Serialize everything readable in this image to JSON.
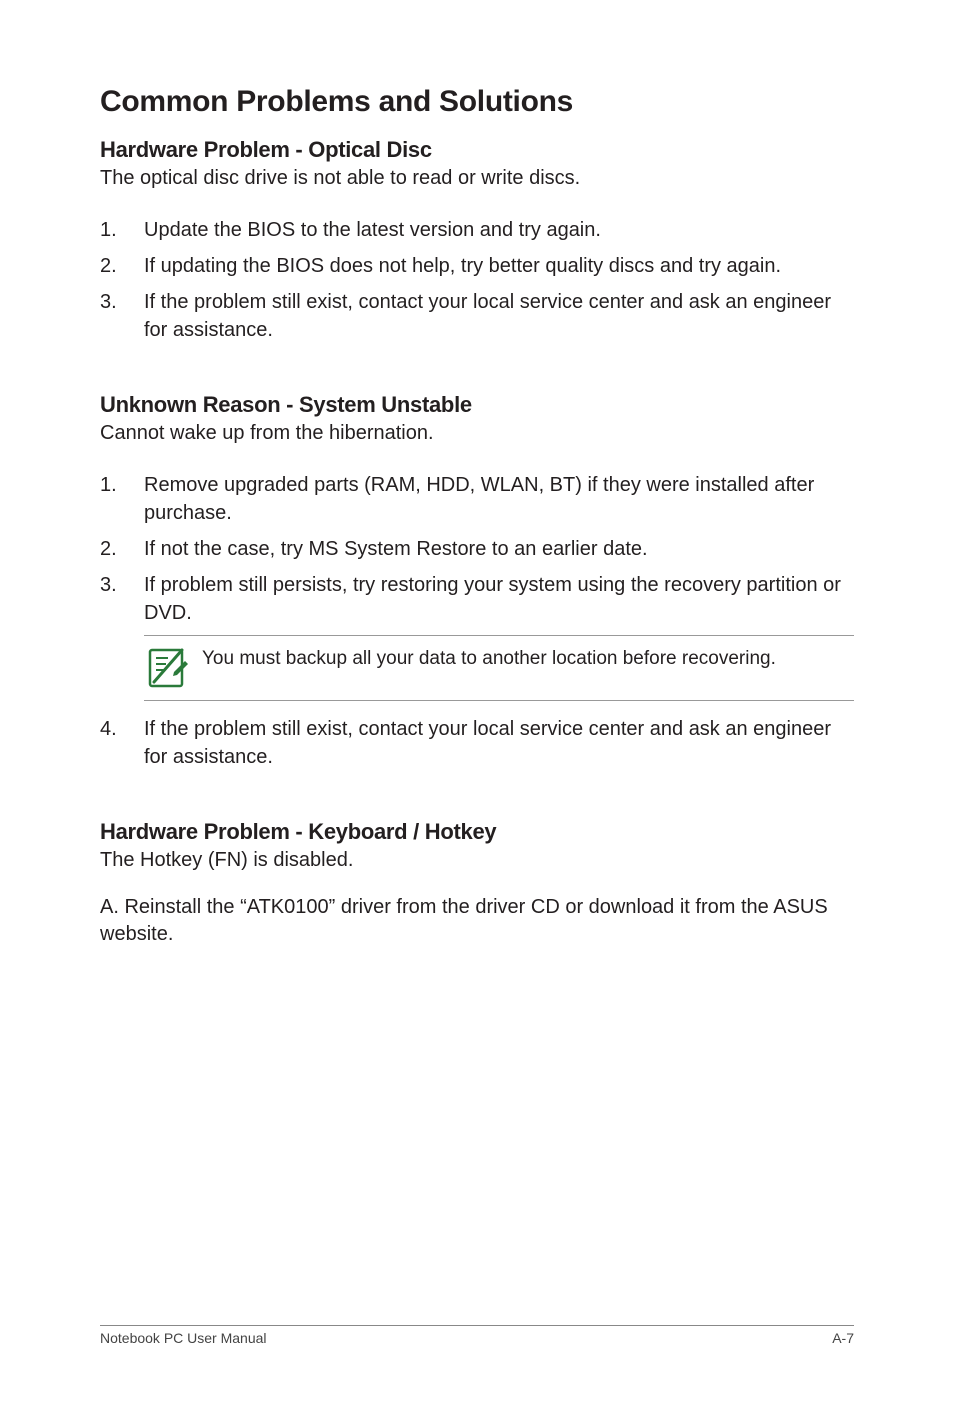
{
  "heading": "Common Problems and Solutions",
  "sections": [
    {
      "title": "Hardware Problem - Optical Disc",
      "intro": "The optical disc drive is not able to read or write discs.",
      "items": [
        {
          "num": "1.",
          "text": "Update the BIOS to the latest version and try again."
        },
        {
          "num": "2.",
          "text": "If updating the BIOS does not help, try better quality discs and try again."
        },
        {
          "num": "3.",
          "text": "If the problem still exist, contact your local service center and ask an engineer for assistance."
        }
      ]
    },
    {
      "title": "Unknown Reason - System Unstable",
      "intro": "Cannot wake up from the hibernation.",
      "items": [
        {
          "num": "1.",
          "text": "Remove upgraded parts (RAM, HDD, WLAN, BT) if they were installed after purchase."
        },
        {
          "num": "2.",
          "text": "If not the case, try MS System Restore to an earlier date."
        },
        {
          "num": "3.",
          "text": "If problem still persists, try restoring your system using the recovery partition or DVD."
        }
      ],
      "note": "You must backup all your data to another location before recovering.",
      "after_items": [
        {
          "num": "4.",
          "text": "If the problem still exist, contact your local service center and ask an engineer for assistance."
        }
      ]
    },
    {
      "title": "Hardware Problem - Keyboard / Hotkey",
      "intro": "The Hotkey (FN) is disabled.",
      "paragraph": "A. Reinstall the “ATK0100” driver from the driver CD or download it from the ASUS website."
    }
  ],
  "footer": {
    "left": "Notebook PC User Manual",
    "right": "A-7"
  },
  "icon_name": "note-icon"
}
